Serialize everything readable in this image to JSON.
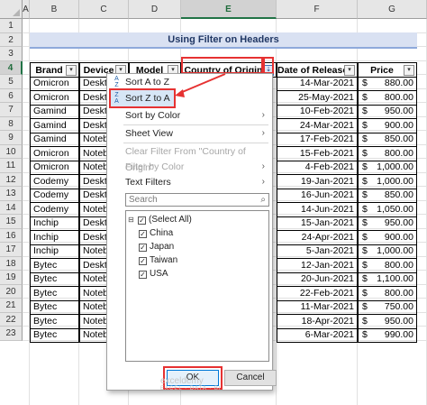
{
  "columns": [
    "A",
    "B",
    "C",
    "D",
    "E",
    "F",
    "G"
  ],
  "selected_column": "E",
  "rows": [
    "1",
    "2",
    "3",
    "4",
    "5",
    "6",
    "7",
    "8",
    "9",
    "10",
    "11",
    "12",
    "13",
    "14",
    "15",
    "16",
    "17",
    "18",
    "19",
    "20",
    "21",
    "22",
    "23"
  ],
  "selected_row": "4",
  "title": "Using Filter on Headers",
  "headers": {
    "brand": "Brand",
    "device": "Device",
    "model": "Model",
    "origin": "Country of Origin",
    "release": "Date of Release",
    "price": "Price"
  },
  "filter_glyph": "▾",
  "filter_active_glyph": "⇣",
  "currency": "$",
  "table_rows": [
    {
      "brand": "Omicron",
      "device": "Desktop",
      "release": "14-Mar-2021",
      "price": "880.00"
    },
    {
      "brand": "Omicron",
      "device": "Desktop",
      "release": "25-May-2021",
      "price": "800.00"
    },
    {
      "brand": "Gamind",
      "device": "Desktop",
      "release": "10-Feb-2021",
      "price": "950.00"
    },
    {
      "brand": "Gamind",
      "device": "Desktop",
      "release": "24-Mar-2021",
      "price": "900.00"
    },
    {
      "brand": "Gamind",
      "device": "Notebook",
      "release": "17-Feb-2021",
      "price": "850.00"
    },
    {
      "brand": "Omicron",
      "device": "Notebook",
      "release": "15-Feb-2021",
      "price": "800.00"
    },
    {
      "brand": "Omicron",
      "device": "Notebook",
      "release": "4-Feb-2021",
      "price": "1,000.00"
    },
    {
      "brand": "Codemy",
      "device": "Desktop",
      "release": "19-Jan-2021",
      "price": "1,000.00"
    },
    {
      "brand": "Codemy",
      "device": "Desktop",
      "release": "16-Jun-2021",
      "price": "850.00"
    },
    {
      "brand": "Codemy",
      "device": "Notebook",
      "release": "14-Jun-2021",
      "price": "1,050.00"
    },
    {
      "brand": "Inchip",
      "device": "Desktop",
      "release": "15-Jan-2021",
      "price": "950.00"
    },
    {
      "brand": "Inchip",
      "device": "Desktop",
      "release": "24-Apr-2021",
      "price": "900.00"
    },
    {
      "brand": "Inchip",
      "device": "Notebook",
      "release": "5-Jan-2021",
      "price": "1,000.00"
    },
    {
      "brand": "Bytec",
      "device": "Desktop",
      "release": "12-Jan-2021",
      "price": "800.00"
    },
    {
      "brand": "Bytec",
      "device": "Notebook",
      "release": "20-Jun-2021",
      "price": "1,100.00"
    },
    {
      "brand": "Bytec",
      "device": "Notebook",
      "release": "22-Feb-2021",
      "price": "800.00"
    },
    {
      "brand": "Bytec",
      "device": "Notebook",
      "release": "11-Mar-2021",
      "price": "750.00"
    },
    {
      "brand": "Bytec",
      "device": "Notebook",
      "release": "18-Apr-2021",
      "price": "950.00"
    },
    {
      "brand": "Bytec",
      "device": "Notebook",
      "release": "6-Mar-2021",
      "price": "990.00"
    }
  ],
  "menu": {
    "sort_az": "Sort A to Z",
    "sort_za": "Sort Z to A",
    "sort_color": "Sort by Color",
    "sheet_view": "Sheet View",
    "clear_filter": "Clear Filter From \"Country of Origin\"",
    "filter_color": "Filter by Color",
    "text_filters": "Text Filters",
    "search_placeholder": "Search",
    "list": [
      "(Select All)",
      "China",
      "Japan",
      "Taiwan",
      "USA"
    ],
    "ok": "OK",
    "cancel": "Cancel",
    "submenu_glyph": "›",
    "check_glyph": "✓",
    "expand_glyph": "⊟",
    "search_glyph": "⌕",
    "sort_az_icon_top": "A",
    "sort_az_icon_bottom": "Z",
    "sort_za_icon_top": "Z",
    "sort_za_icon_bottom": "A"
  },
  "watermark": {
    "brand": "exceldemy",
    "tagline": "EXCEL · DATA · BI"
  },
  "colors": {
    "accent": "#217346",
    "highlight": "#e63232",
    "title_bg": "#d9e1f2"
  }
}
